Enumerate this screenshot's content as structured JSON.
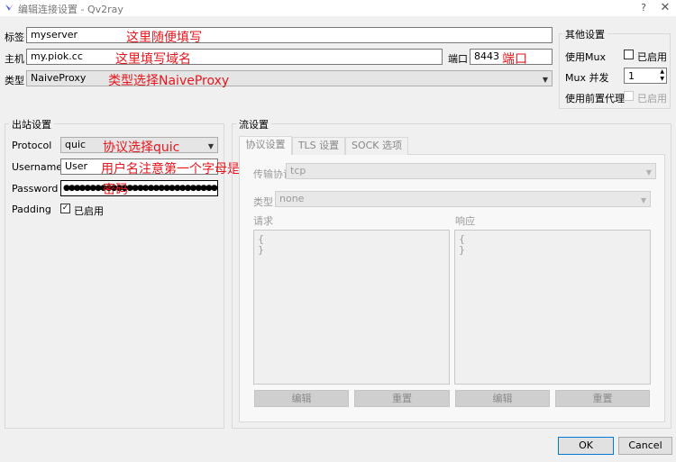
{
  "window": {
    "title": "编辑连接设置 - Qv2ray",
    "help": "?",
    "close": "✕"
  },
  "connection": {
    "tag_label": "标签",
    "tag_value": "myserver",
    "tag_note": "这里随便填写",
    "host_label": "主机",
    "host_value": "my.piok.cc",
    "host_note": "这里填写域名",
    "port_label": "端口",
    "port_value": "8443",
    "port_note": "端口",
    "type_label": "类型",
    "type_value": "NaiveProxy",
    "type_note": "类型选择NaiveProxy"
  },
  "other": {
    "title": "其他设置",
    "mux_label": "使用Mux",
    "mux_checkbox": "已启用",
    "mux_checked": false,
    "concurrency_label": "Mux 并发",
    "concurrency_value": "1",
    "proxy_label": "使用前置代理",
    "proxy_checkbox": "已启用",
    "proxy_checked": false
  },
  "outbound": {
    "title": "出站设置",
    "protocol_label": "Protocol",
    "protocol_value": "quic",
    "protocol_note": "协议选择quic",
    "username_label": "Username",
    "username_value": "User",
    "username_note": "用户名注意第一个字母是大写",
    "password_label": "Password",
    "password_value": "●●●●●●●●●●●●●●●●●●●●●●●●●●●●●●●●",
    "password_note": "密码",
    "padding_label": "Padding",
    "padding_checkbox": "已启用",
    "padding_checked": true
  },
  "stream": {
    "title": "流设置",
    "tabs": [
      "协议设置",
      "TLS 设置",
      "SOCK 选项"
    ],
    "active_tab": 0,
    "transport_label": "传输协议",
    "transport_value": "tcp",
    "type_label": "类型",
    "type_value": "none",
    "request_label": "请求",
    "response_label": "响应",
    "request_text": "{\n}",
    "response_text": "{\n}",
    "edit_label": "编辑",
    "reset_label": "重置"
  },
  "dialog": {
    "ok": "OK",
    "cancel": "Cancel"
  },
  "colors": {
    "annotation": "#e5161d",
    "accent": "#0078d7"
  }
}
